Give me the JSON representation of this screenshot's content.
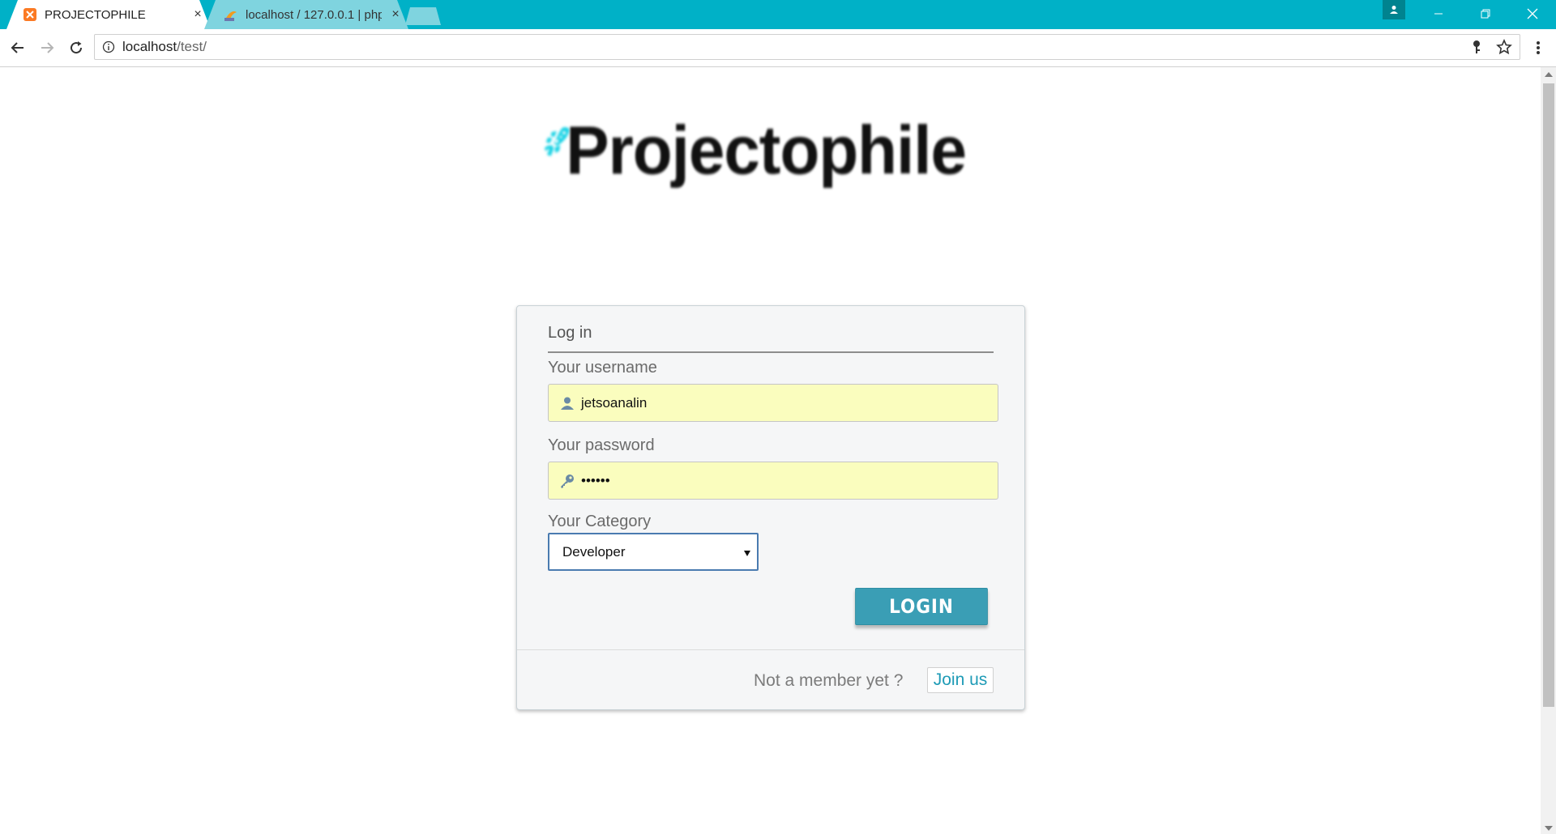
{
  "browser": {
    "tabs": [
      {
        "title": "PROJECTOPHILE",
        "active": true,
        "favicon": "xampp-icon",
        "close": "×"
      },
      {
        "title": "localhost / 127.0.0.1 | php",
        "active": false,
        "favicon": "phpmyadmin-icon",
        "close": "×"
      }
    ],
    "url_host": "localhost",
    "url_path": "/test/",
    "colors": {
      "titlebar": "#00b1c7",
      "inactive_tab": "#7fd4df"
    }
  },
  "page": {
    "logo_text": "Projectophile",
    "login": {
      "heading": "Log in",
      "username_label": "Your username",
      "username_value": "jetsoanalin",
      "password_label": "Your password",
      "password_value": "••••••",
      "category_label": "Your Category",
      "category_value": "Developer",
      "submit_label": "LOGIN",
      "footer_text": "Not a member yet ?",
      "join_label": "Join us"
    },
    "colors": {
      "accent": "#1e9bb6",
      "button": "#3a9eb5",
      "autofill": "#fafdbe"
    }
  }
}
